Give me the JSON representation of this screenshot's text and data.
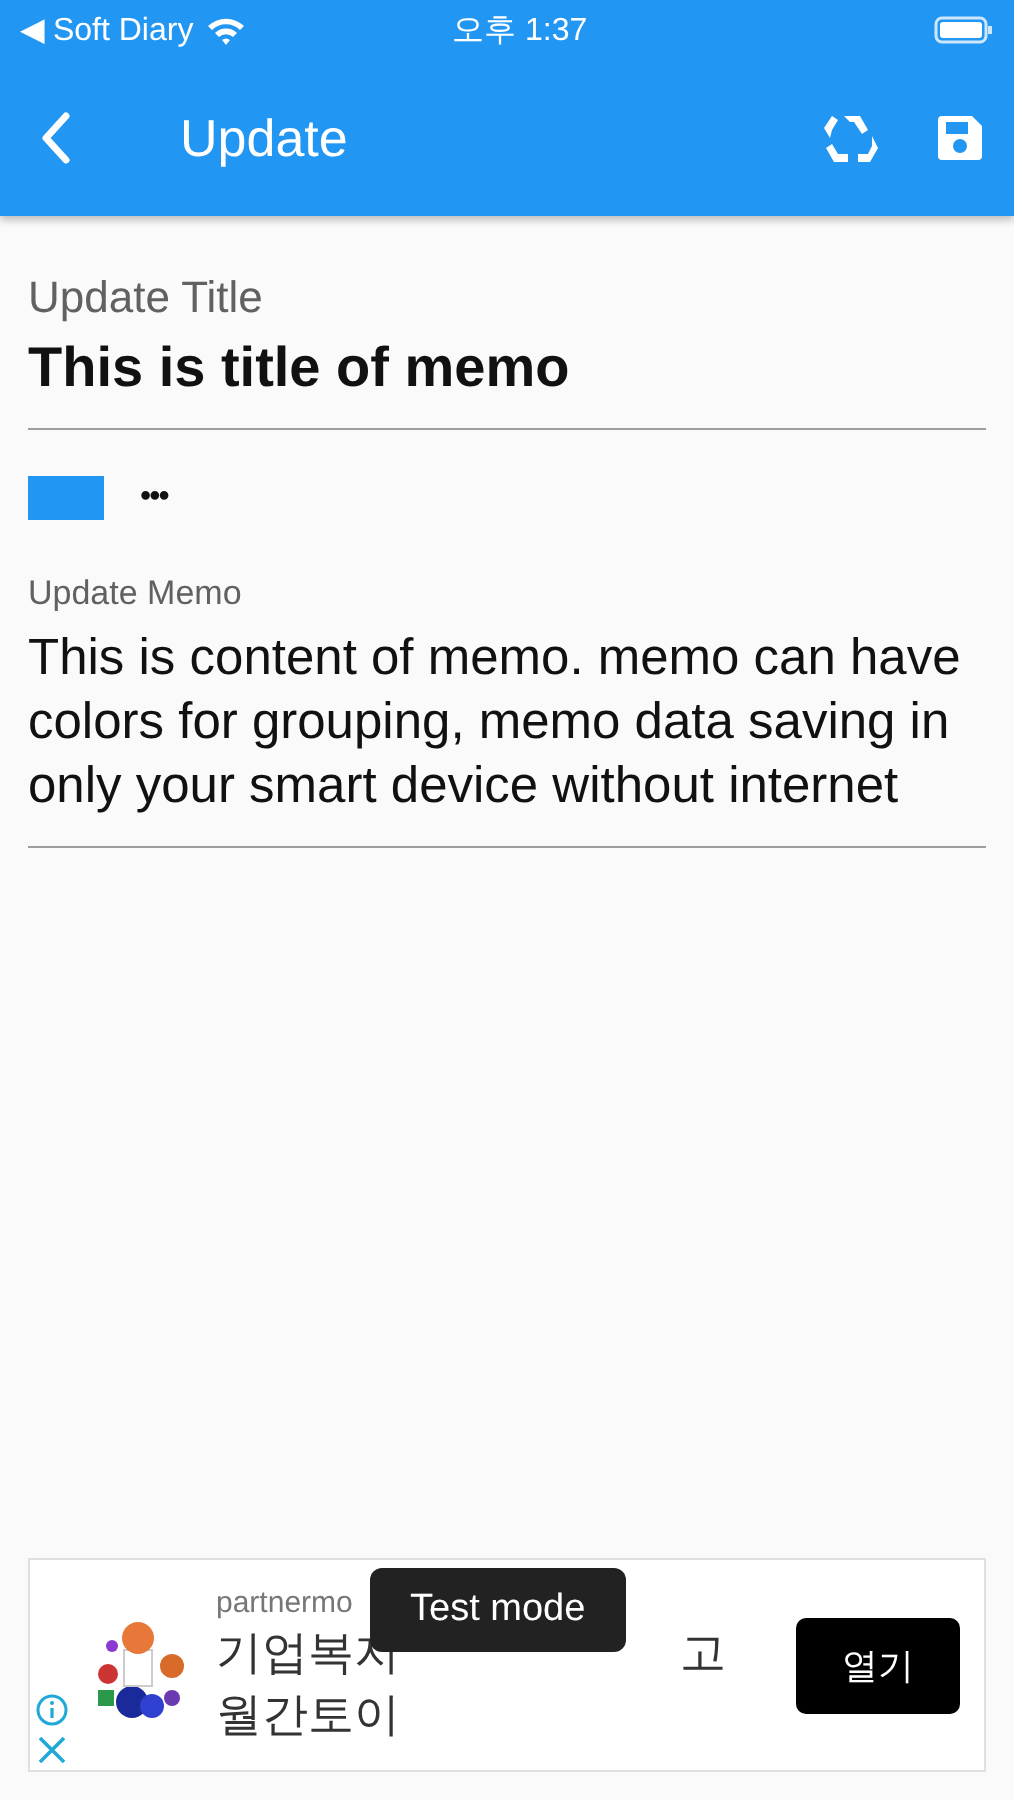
{
  "status_bar": {
    "back_app": "◀ Soft Diary",
    "time": "오후 1:37"
  },
  "app_bar": {
    "title": "Update"
  },
  "title_field": {
    "label": "Update Title",
    "value": "This is title of memo"
  },
  "color": {
    "color": "#2196f3",
    "more": "•••"
  },
  "memo_field": {
    "label": "Update Memo",
    "value": "This is content of memo. memo can have colors for grouping, memo data saving in only your smart device without internet"
  },
  "ad": {
    "source": "partnermo",
    "headline_start": "기업복지",
    "headline_end": "고",
    "headline_line2": "월간토이",
    "button": "열기"
  },
  "toast": {
    "text": "Test mode"
  }
}
